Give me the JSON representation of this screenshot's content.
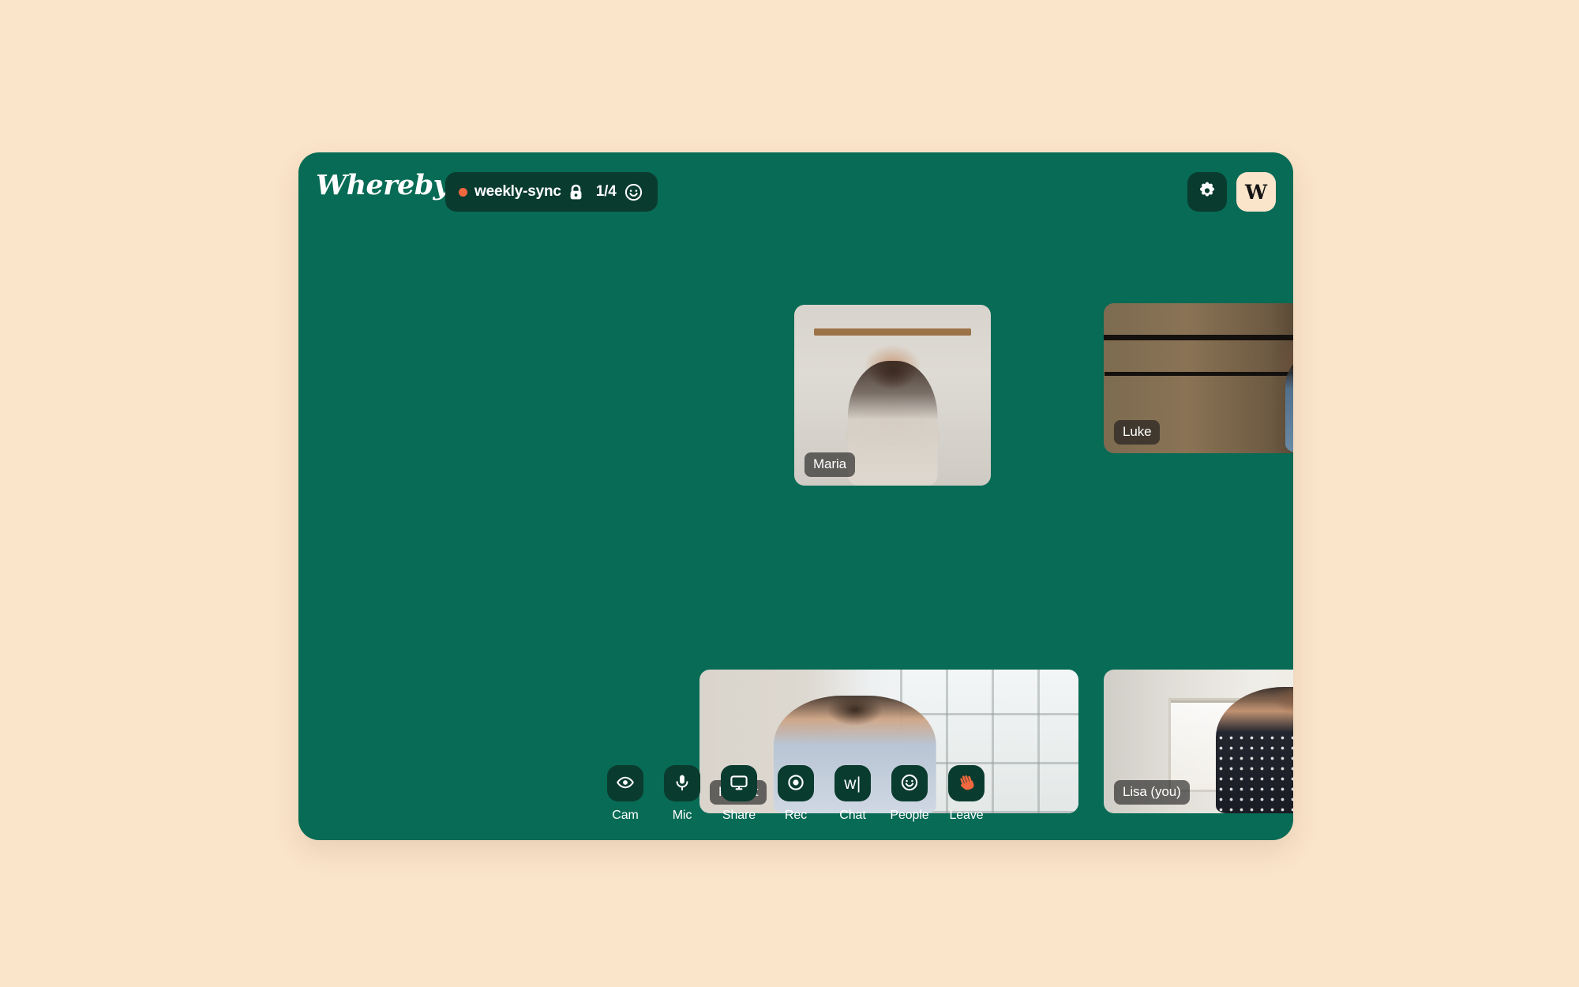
{
  "theme": {
    "page_background": "#fae4ca",
    "window_background": "#076b55",
    "chip_background": "#0a3b2f",
    "accent_coral": "#f4683f",
    "avatar_background": "#fae4ca"
  },
  "header": {
    "brand": "Whereby",
    "room": {
      "recording_dot": "record-dot",
      "name": "weekly-sync",
      "lock_icon": "lock-icon",
      "participant_count": "1/4",
      "mood_icon": "smiley-icon"
    },
    "settings_label": "settings-icon",
    "avatar_initial": "W"
  },
  "grid": {
    "tiles": [
      {
        "name": "Maria",
        "scene": "scene-maria",
        "id": "tile-maria"
      },
      {
        "name": "Luke",
        "scene": "scene-luke",
        "id": "tile-luke"
      },
      {
        "name": "Robert",
        "scene": "scene-robert",
        "id": "tile-robert"
      },
      {
        "name": "Lisa (you)",
        "scene": "scene-lisa",
        "id": "tile-lisa"
      }
    ]
  },
  "toolbar": {
    "items": [
      {
        "label": "Cam",
        "icon": "eye-icon"
      },
      {
        "label": "Mic",
        "icon": "microphone-icon"
      },
      {
        "label": "Share",
        "icon": "screen-share-icon"
      },
      {
        "label": "Rec",
        "icon": "record-circle-icon"
      },
      {
        "label": "Chat",
        "icon": "chat-w-cursor-icon",
        "glyph": "w|"
      },
      {
        "label": "People",
        "icon": "smiley-people-icon"
      },
      {
        "label": "Leave",
        "icon": "waving-hand-icon"
      }
    ]
  }
}
